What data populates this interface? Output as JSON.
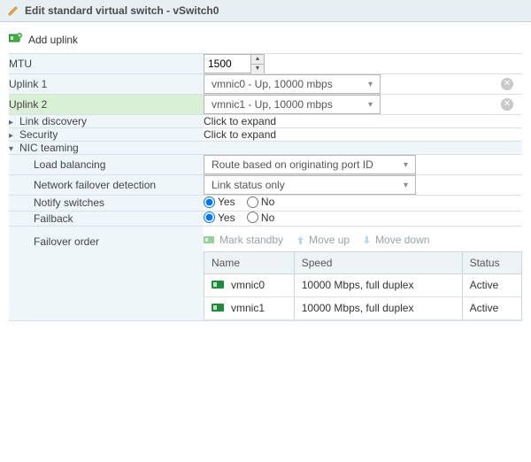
{
  "title": "Edit standard virtual switch - vSwitch0",
  "add_uplink_label": "Add uplink",
  "rows": {
    "mtu_label": "MTU",
    "mtu_value": "1500",
    "uplink1_label": "Uplink 1",
    "uplink1_value": "vmnic0 - Up, 10000 mbps",
    "uplink2_label": "Uplink 2",
    "uplink2_value": "vmnic1 - Up, 10000 mbps",
    "link_discovery_label": "Link discovery",
    "link_discovery_value": "Click to expand",
    "security_label": "Security",
    "security_value": "Click to expand",
    "nic_teaming_label": "NIC teaming",
    "load_balancing_label": "Load balancing",
    "load_balancing_value": "Route based on originating port ID",
    "failover_detection_label": "Network failover detection",
    "failover_detection_value": "Link status only",
    "notify_switches_label": "Notify switches",
    "failback_label": "Failback",
    "failover_order_label": "Failover order"
  },
  "radio": {
    "yes": "Yes",
    "no": "No"
  },
  "fo_actions": {
    "mark_standby": "Mark standby",
    "move_up": "Move up",
    "move_down": "Move down"
  },
  "fo_table": {
    "headers": {
      "name": "Name",
      "speed": "Speed",
      "status": "Status"
    },
    "rows": [
      {
        "name": "vmnic0",
        "speed": "10000 Mbps, full duplex",
        "status": "Active"
      },
      {
        "name": "vmnic1",
        "speed": "10000 Mbps, full duplex",
        "status": "Active"
      }
    ]
  }
}
